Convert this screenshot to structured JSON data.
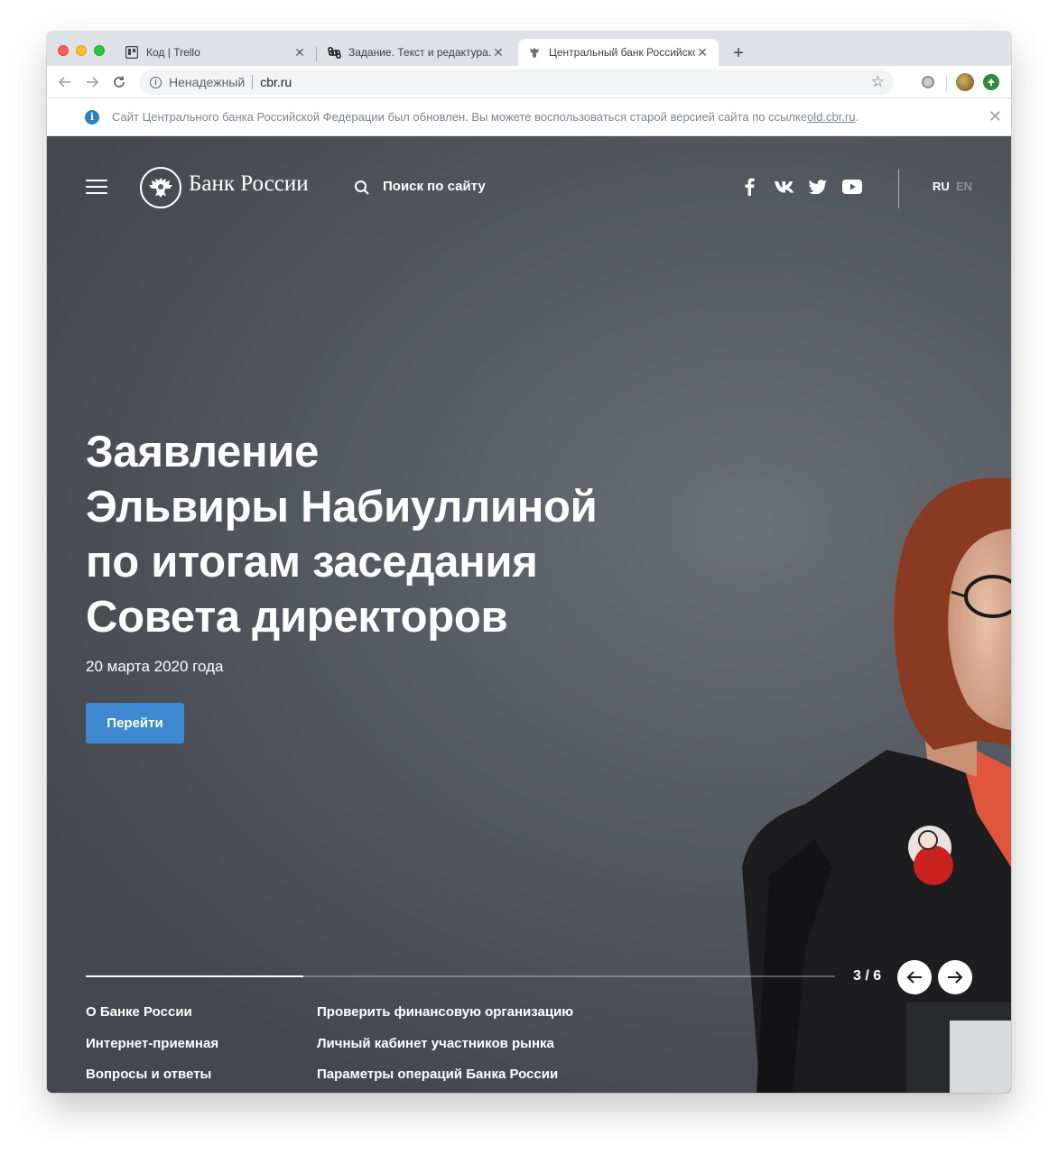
{
  "browser": {
    "tabs": [
      {
        "title": "Код | Trello",
        "favicon": "trello-icon"
      },
      {
        "title": "Задание. Текст и редактура. П",
        "favicon": "command-icon"
      },
      {
        "title": "Центральный банк Российской",
        "favicon": "cbr-eagle-icon",
        "active": true
      }
    ],
    "new_tab": "+",
    "close_glyph": "✕",
    "security_label": "Ненадежный",
    "url": "cbr.ru"
  },
  "infobar": {
    "message": "Сайт Центрального банка Российской Федерации был обновлен. Вы можете воспользоваться старой версией сайта по ссылке ",
    "link_text": "old.cbr.ru",
    "suffix": "."
  },
  "header": {
    "logo_text": "Банк России",
    "search_label": "Поиск по сайту",
    "social": [
      "facebook-icon",
      "vk-icon",
      "twitter-icon",
      "youtube-icon"
    ],
    "lang_ru": "RU",
    "lang_en": "EN"
  },
  "slide": {
    "headline_lines": [
      "Заявление",
      "Эльвиры Набиуллиной",
      "по итогам заседания",
      "Совета директоров"
    ],
    "date": "20 марта 2020 года",
    "button": "Перейти",
    "counter": "3 / 6",
    "progress_fraction": 0.29
  },
  "quick_links": {
    "col1": [
      "О Банке России",
      "Интернет-приемная",
      "Вопросы и ответы"
    ],
    "col2": [
      "Проверить финансовую организацию",
      "Личный кабинет участников рынка",
      "Параметры операций Банка России"
    ]
  },
  "colors": {
    "accent": "#3d88cf",
    "hero_bg": "#55595f"
  }
}
